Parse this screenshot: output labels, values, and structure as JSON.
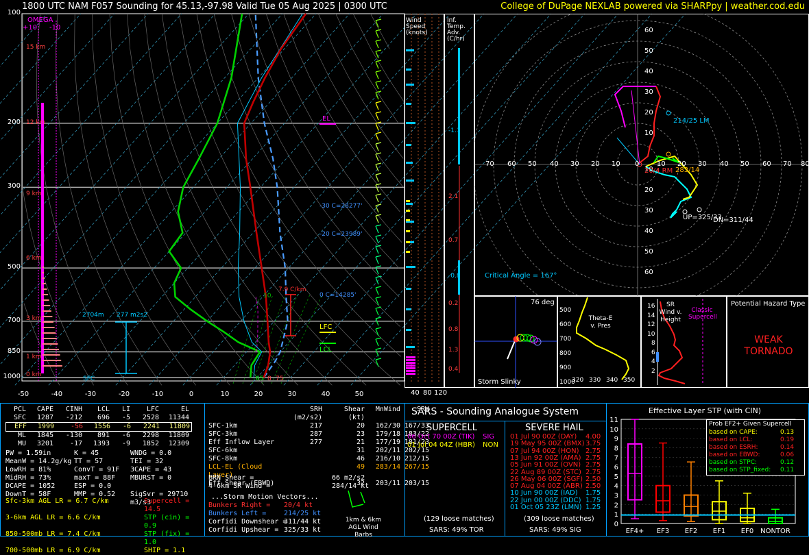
{
  "header": {
    "left": "1800 UTC NAM F057 Sounding for 45.13,-97.98 Valid  Tue 05 Aug 2025 | 0300 UTC",
    "right": "College of DuPage NEXLAB powered via SHARPpy | weather.cod.edu"
  },
  "colors": {
    "temp": "#b40000",
    "dew": "#00c000",
    "wetbulb": "#00c8ff",
    "parcel": "#ff00ff",
    "virt": "#4090ff",
    "accent": "#ffff00"
  },
  "skewt": {
    "pressure_ticks": [
      "100",
      "200",
      "300",
      "500",
      "700",
      "850",
      "1000"
    ],
    "temp_ticks": [
      "-50",
      "-40",
      "-30",
      "-20",
      "-10",
      "0",
      "10",
      "20",
      "30",
      "40",
      "50"
    ],
    "height_labels": [
      "15 km",
      "12 km",
      "9 km",
      "6 km",
      "3 km",
      "1 km",
      "0 km"
    ],
    "omega": "OMEGA",
    "omega_ticks": [
      "+10",
      "-10"
    ],
    "el": "EL",
    "lfc": "LFC",
    "lcl": "LCL",
    "annot": {
      "m30": "-30 C=28277'",
      "m20": "-20 C=23989'",
      "zero": "0 C=14285'",
      "lapse": "7.9 C/km",
      "sfc_t": "75",
      "sfc_td": "65",
      "sfc_mid": "8",
      "depth": "2704m",
      "esrh": "277 m2s2",
      "sfc": "SFC",
      "ten": "10"
    }
  },
  "windspeed": {
    "title": "Wind Speed (knots)",
    "ticks": [
      "40",
      "80",
      "120"
    ]
  },
  "tempadv": {
    "title": "Inf. Temp. Adv. (C/hr)",
    "vals": [
      "-1.1",
      "2.1",
      "0.7",
      "-0.8",
      "0.2",
      "0.8",
      "1.3",
      "0.4"
    ]
  },
  "hodo": {
    "rings": [
      "60",
      "50",
      "40",
      "30",
      "20",
      "10",
      "10",
      "20",
      "30",
      "40",
      "50",
      "60"
    ],
    "xlabels": [
      "70",
      "60",
      "50",
      "40",
      "30",
      "20",
      "10",
      "0",
      "10",
      "20",
      "30",
      "40",
      "50",
      "60",
      "70",
      "80"
    ],
    "lm": "214/25 LM",
    "rm": "20/4 RM",
    "mean": "283/14",
    "up": "UP=325/33",
    "dn": "DN=311/44",
    "crit": "Critical Angle = 167°"
  },
  "slinky": {
    "deg": "76 deg",
    "label": "Storm Slinky"
  },
  "theta": {
    "label": "Theta-E v. Pres",
    "pticks": [
      "500",
      "600",
      "700",
      "800",
      "900",
      "1000"
    ],
    "xticks": [
      "320",
      "330",
      "340",
      "350"
    ]
  },
  "srwind": {
    "title": "SR Wind v. Height",
    "hticks": [
      "16",
      "14",
      "12",
      "10",
      "8",
      "6",
      "4",
      "2"
    ],
    "classic": "Classic Supercell"
  },
  "hazard": {
    "title": "Potential Hazard Type",
    "value": "WEAK TORNADO"
  },
  "parcels": {
    "headers": [
      "PCL",
      "CAPE",
      "CINH",
      "LCL",
      "LI",
      "LFC",
      "EL"
    ],
    "rows": [
      [
        "SFC",
        "1287",
        "-212",
        "696",
        "-5",
        "2528",
        "11344"
      ],
      [
        "EFF",
        "1999",
        "-56",
        "1556",
        "-6",
        "2241",
        "11809"
      ],
      [
        "ML",
        "1845",
        "-130",
        "891",
        "-6",
        "2298",
        "11809"
      ],
      [
        "MU",
        "3201",
        "-17",
        "1393",
        "-9",
        "1852",
        "12309"
      ]
    ]
  },
  "indices": [
    [
      "PW = 1.59in",
      "K = 45",
      "WNDG = 0.0"
    ],
    [
      "MeanW = 14.2g/kg",
      "TT = 57",
      "TEI = 32"
    ],
    [
      "LowRH = 81%",
      "ConvT = 91F",
      "3CAPE = 43"
    ],
    [
      "MidRH = 73%",
      "maxT = 88F",
      "MBURST = 0"
    ],
    [
      "DCAPE = 1052",
      "ESP = 0.0",
      ""
    ],
    [
      "DownT = 58F",
      "MMP = 0.52",
      "SigSvr = 29710 m3/s3"
    ]
  ],
  "lapse": [
    [
      "Sfc-3km AGL LR = 6.7 C/km",
      "Supercell = 14.5"
    ],
    [
      "3-6km AGL LR = 6.6 C/km",
      "STP (cin) = 0.9"
    ],
    [
      "850-500mb LR = 7.4 C/km",
      "STP (fix) = 1.0"
    ],
    [
      "700-500mb LR = 6.9 C/km",
      "SHIP = 1.1"
    ]
  ],
  "kin": {
    "headers": [
      "SRH (m2/s2)",
      "Shear (kt)",
      "MnWind",
      "SRW"
    ],
    "rows": [
      [
        "SFC-1km",
        "217",
        "20",
        "162/30",
        "167/33"
      ],
      [
        "SFC-3km",
        "287",
        "23",
        "179/18",
        "183/22"
      ],
      [
        "Eff Inflow Layer",
        "277",
        "21",
        "177/19",
        "181/23"
      ],
      [
        "",
        "",
        "",
        "",
        ""
      ],
      [
        "SFC-6km",
        "31",
        "202/11",
        "202/15",
        ""
      ],
      [
        "SFC-8km",
        "46",
        "216/10",
        "212/15",
        ""
      ],
      [
        "LCL-EL (Cloud Layer)",
        "49",
        "283/14",
        "267/15",
        ""
      ],
      [
        "Eff Shear (EBWD)",
        "32",
        "203/11",
        "203/15",
        ""
      ]
    ],
    "brn": "BRN Shear =",
    "brn_v": "66 m2/s2",
    "srw": "4-6km SR Wind =",
    "srw_v": "284/14 kt",
    "smv": "...Storm Motion Vectors...",
    "br": "Bunkers Right =",
    "br_v": "20/4 kt",
    "bl": "Bunkers Left =",
    "bl_v": "214/25 kt",
    "cd": "Corfidi Downshear =",
    "cd_v": "311/44 kt",
    "cu": "Corfidi Upshear =",
    "cu_v": "325/33 kt",
    "barbs": "1km & 6km AGL Wind Barbs"
  },
  "sars": {
    "title": "SARS - Sounding Analogue System",
    "sc_title": "SUPERCELL",
    "sc": [
      [
        "06 Oct 70 00Z (TIK)",
        "SIG"
      ],
      [
        "01 Jul 04 04Z (HBR)",
        "NON"
      ]
    ],
    "sc_foot": "(129 loose matches)",
    "sc_pct": "SARS: 49% TOR",
    "hail_title": "SEVERE HAIL",
    "hail": [
      [
        "01 Jul 90 00Z (DAY)",
        "4.00"
      ],
      [
        "19 May 95 00Z (BMX)",
        "3.75"
      ],
      [
        "07 Jul 94 00Z (HON)",
        "2.75"
      ],
      [
        "13 Jun 92 00Z (AMA)",
        "2.75"
      ],
      [
        "05 Jun 91 00Z (OVN)",
        "2.75"
      ],
      [
        "22 Aug 89 00Z (STC)",
        "2.75"
      ],
      [
        "26 May 06 00Z (SGF)",
        "2.50"
      ],
      [
        "07 Aug 04 00Z (ABR)",
        "2.50"
      ],
      [
        "10 Jun 90 00Z (IAD)",
        "1.75"
      ],
      [
        "22 Jun 00 00Z (DDC)",
        "1.75"
      ],
      [
        "01 Oct 05 23Z (LMN)",
        "1.25"
      ]
    ],
    "hail_foot": "(309 loose matches)",
    "hail_pct": "SARS: 49% SIG"
  },
  "stp": {
    "title": "Effective Layer STP (with CIN)",
    "yticks": [
      "11",
      "10",
      "9",
      "8",
      "7",
      "6",
      "5",
      "4",
      "3",
      "2",
      "1",
      "0"
    ],
    "cats": [
      "EF4+",
      "EF3",
      "EF2",
      "EF1",
      "EF0",
      "NONTOR"
    ],
    "prob_title": "Prob EF2+ Given Supercell",
    "prob": [
      [
        "based on CAPE:",
        "0.13"
      ],
      [
        "based on LCL:",
        "0.19"
      ],
      [
        "based on ESRH:",
        "0.14"
      ],
      [
        "based on EBWD:",
        "0.06"
      ],
      [
        "based on STPC:",
        "0.12"
      ],
      [
        "based on STP_fixed:",
        "0.11"
      ]
    ],
    "boxes": [
      {
        "lo": 0.5,
        "q1": 2.5,
        "med": 5.3,
        "q3": 8.4,
        "hi": 11.0,
        "color": "#ff00ff"
      },
      {
        "lo": 0.3,
        "q1": 1.2,
        "med": 2.4,
        "q3": 4.0,
        "hi": 8.5,
        "color": "#ff0000"
      },
      {
        "lo": 0.2,
        "q1": 0.8,
        "med": 1.8,
        "q3": 3.0,
        "hi": 6.5,
        "color": "#ff8000"
      },
      {
        "lo": 0.0,
        "q1": 0.4,
        "med": 1.3,
        "q3": 2.3,
        "hi": 4.5,
        "color": "#ffff00"
      },
      {
        "lo": 0.0,
        "q1": 0.2,
        "med": 0.6,
        "q3": 1.6,
        "hi": 3.2,
        "color": "#ffff00"
      },
      {
        "lo": 0.0,
        "q1": 0.0,
        "med": 0.2,
        "q3": 0.6,
        "hi": 1.5,
        "color": "#00ff00"
      }
    ],
    "current": 0.9
  }
}
